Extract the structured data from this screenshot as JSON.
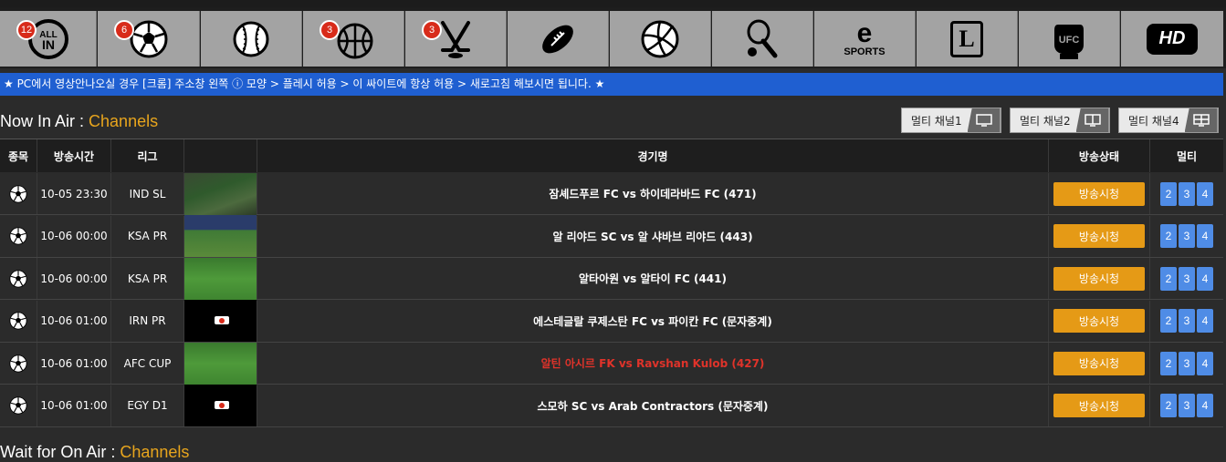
{
  "sports_nav": [
    {
      "name": "all-in",
      "badge": "12",
      "icon": "all-in-icon",
      "label": "ALL IN"
    },
    {
      "name": "soccer",
      "badge": "6",
      "icon": "soccer-ball-icon"
    },
    {
      "name": "baseball",
      "badge": "",
      "icon": "baseball-icon"
    },
    {
      "name": "basketball",
      "badge": "3",
      "icon": "basketball-icon"
    },
    {
      "name": "hockey",
      "badge": "3",
      "icon": "hockey-icon"
    },
    {
      "name": "football",
      "badge": "",
      "icon": "football-icon"
    },
    {
      "name": "volleyball",
      "badge": "",
      "icon": "volleyball-icon"
    },
    {
      "name": "tennis",
      "badge": "",
      "icon": "tennis-icon"
    },
    {
      "name": "esports",
      "badge": "",
      "icon": "esports-icon",
      "label_top": "e",
      "label_bottom": "SPORTS"
    },
    {
      "name": "lol",
      "badge": "",
      "icon": "lol-icon",
      "label": "L"
    },
    {
      "name": "ufc",
      "badge": "",
      "icon": "ufc-glove-icon",
      "label": "UFC"
    },
    {
      "name": "hd",
      "badge": "",
      "icon": "hd-icon",
      "label": "HD"
    }
  ],
  "notice": "★ PC에서 영상안나오실 경우 [크롬] 주소창 왼쪽 ⓘ 모양 > 플레시 허용 > 이 싸이트에 항상 허용 > 새로고침 해보시면 됩니다. ★",
  "now_in_air": {
    "prefix": "Now In Air : ",
    "accent": "Channels"
  },
  "wait_for_on_air": {
    "prefix": "Wait for On Air : ",
    "accent": "Channels"
  },
  "multi_buttons": [
    "멀티 채널1",
    "멀티 채널2",
    "멀티 채널4"
  ],
  "table": {
    "headers": [
      "종목",
      "방송시간",
      "리그",
      "",
      "경기명",
      "방송상태",
      "멀티"
    ],
    "rows": [
      {
        "time": "10-05 23:30",
        "league": "IND SL",
        "match": "잠셰드푸르 FC vs 하이데라바드 FC (471)",
        "status": "방송시청",
        "thumb": "pitch",
        "highlight": false
      },
      {
        "time": "10-06 00:00",
        "league": "KSA PR",
        "match": "알 리야드 SC vs 알 샤바브 리야드 (443)",
        "status": "방송시청",
        "thumb": "stadium",
        "highlight": false
      },
      {
        "time": "10-06 00:00",
        "league": "KSA PR",
        "match": "알타아원 vs 알타이 FC (441)",
        "status": "방송시청",
        "thumb": "grass",
        "highlight": false
      },
      {
        "time": "10-06 01:00",
        "league": "IRN PR",
        "match": "에스테글랄 쿠제스탄 FC vs 파이칸 FC (문자중계)",
        "status": "방송시청",
        "thumb": "black",
        "highlight": false
      },
      {
        "time": "10-06 01:00",
        "league": "AFC CUP",
        "match": "알틴 아시르 FK vs Ravshan Kulob (427)",
        "status": "방송시청",
        "thumb": "grass",
        "highlight": true
      },
      {
        "time": "10-06 01:00",
        "league": "EGY D1",
        "match": "스모하 SC vs Arab Contractors (문자중계)",
        "status": "방송시청",
        "thumb": "black",
        "highlight": false
      }
    ],
    "multi_labels": [
      "2",
      "3",
      "4"
    ]
  },
  "colors": {
    "accent": "#e8a51d",
    "notice_bg": "#1f5fd1",
    "watch_btn": "#e59a16",
    "multi_btn": "#4f8ce6",
    "highlight_text": "#e0332a"
  }
}
